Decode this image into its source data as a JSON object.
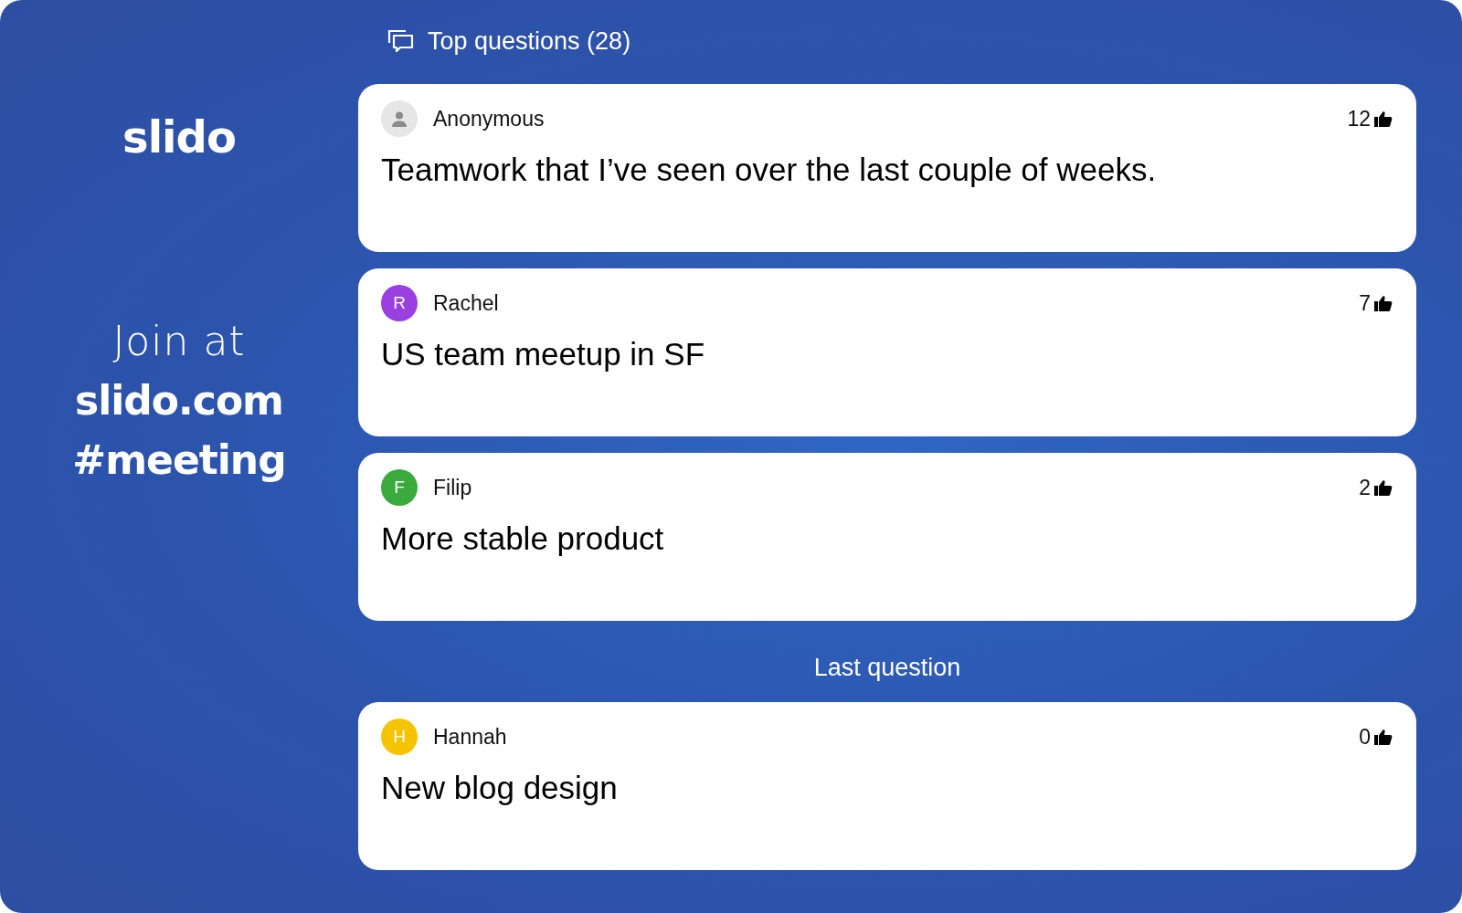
{
  "brand": {
    "logo": "slido",
    "join_label": "Join at",
    "site": "slido.com",
    "code": "#meeting"
  },
  "top_questions": {
    "title": "Top questions (28)",
    "questions": [
      {
        "author": "Anonymous",
        "avatar": {
          "kind": "anonymous",
          "color": "#e6e6e6"
        },
        "likes": "12",
        "text": "Teamwork that I’ve seen over the last couple of weeks."
      },
      {
        "author": "Rachel",
        "avatar": {
          "kind": "initial",
          "letter": "R",
          "color": "#9a3fe0"
        },
        "likes": "7",
        "text": "US team meetup in SF"
      },
      {
        "author": "Filip",
        "avatar": {
          "kind": "initial",
          "letter": "F",
          "color": "#3aaa3c"
        },
        "likes": "2",
        "text": "More stable product"
      }
    ]
  },
  "last_question": {
    "label": "Last question",
    "question": {
      "author": "Hannah",
      "avatar": {
        "kind": "initial",
        "letter": "H",
        "color": "#f5c400"
      },
      "likes": "0",
      "text": "New blog design"
    }
  }
}
